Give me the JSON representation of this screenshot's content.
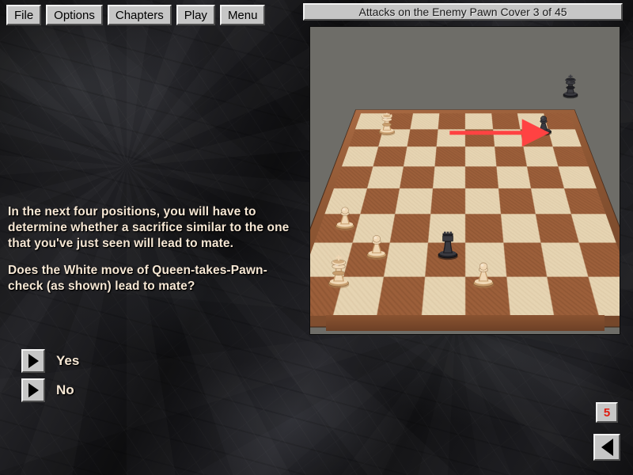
{
  "window": {
    "title": "Attacks on the Enemy Pawn Cover  3 of 45"
  },
  "menubar": {
    "items": [
      {
        "label": "File",
        "name": "menu-file"
      },
      {
        "label": "Options",
        "name": "menu-options"
      },
      {
        "label": "Chapters",
        "name": "menu-chapters"
      },
      {
        "label": "Play",
        "name": "menu-play"
      },
      {
        "label": "Menu",
        "name": "menu-menu"
      }
    ]
  },
  "instructions": {
    "paragraph1": "In the next four positions, you will have to determine whether a sacrifice similar to the one that you've just seen will lead to mate.",
    "paragraph2": "Does the White move of Queen-takes-Pawn-check (as shown) lead to mate?"
  },
  "answers": {
    "options": [
      {
        "label": "Yes",
        "name": "answer-yes"
      },
      {
        "label": "No",
        "name": "answer-no"
      }
    ]
  },
  "navigation": {
    "counter": "5",
    "counter_color": "#e01b10",
    "back_icon": "triangle-left-icon"
  },
  "board": {
    "light_square_color": "#e6d4b2",
    "dark_square_color": "#9c5f3a",
    "frame_color": "#8d5633",
    "panel_background": "#6e6d68",
    "arrow_color": "#ff4242",
    "arrow_from": "d7",
    "arrow_to": "g7",
    "pieces": [
      {
        "piece": "white-queen",
        "file": 2,
        "rank": 7,
        "color": "white"
      },
      {
        "piece": "black-pawn",
        "file": 7,
        "rank": 7,
        "color": "black"
      },
      {
        "piece": "black-king",
        "file": 8,
        "rank": 8,
        "color": "black"
      },
      {
        "piece": "white-pawn",
        "file": 1,
        "rank": 4,
        "color": "white"
      },
      {
        "piece": "white-pawn",
        "file": 2,
        "rank": 3,
        "color": "white"
      },
      {
        "piece": "white-king",
        "file": 1,
        "rank": 2,
        "color": "white"
      },
      {
        "piece": "black-rook",
        "file": 4,
        "rank": 3,
        "color": "black"
      },
      {
        "piece": "white-pawn",
        "file": 5,
        "rank": 2,
        "color": "white"
      }
    ]
  },
  "theme": {
    "chrome_face": "#c6c6c6",
    "text_color": "#f6e7d4",
    "background": "#1b1b1d"
  }
}
